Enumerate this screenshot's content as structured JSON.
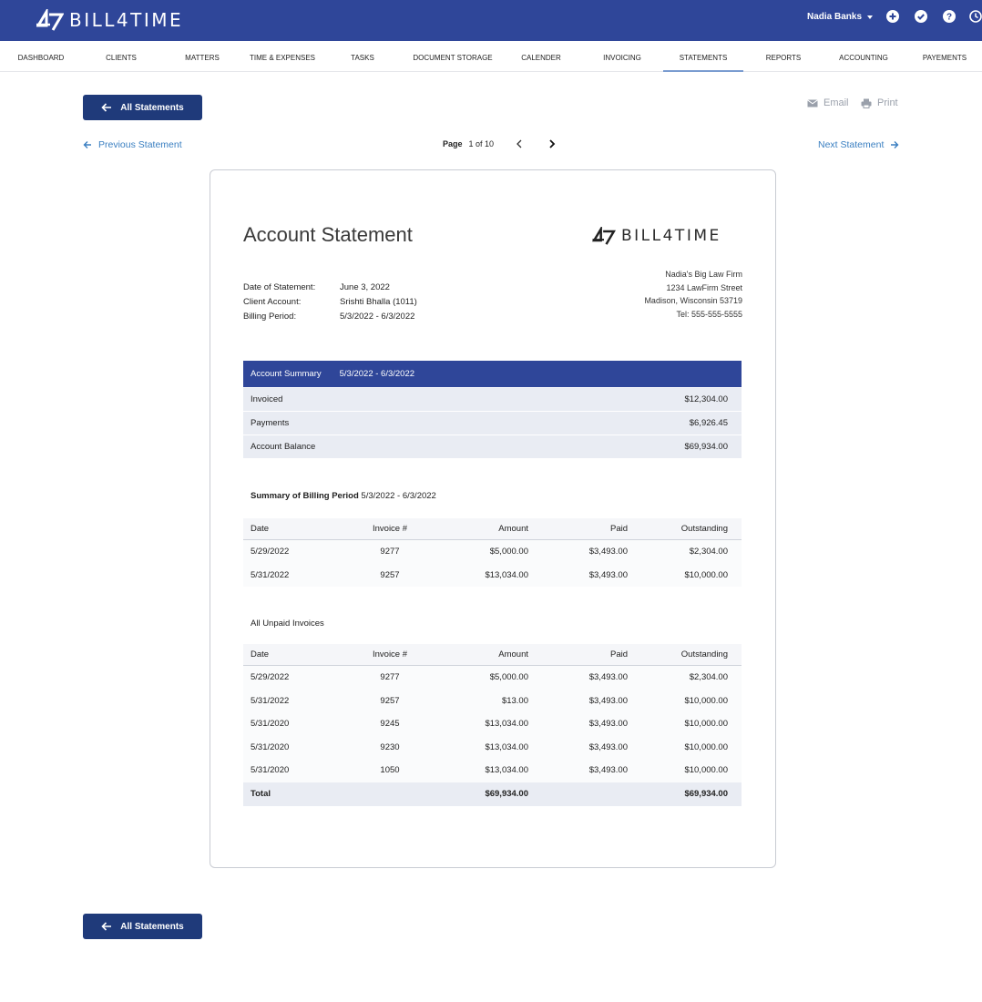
{
  "header": {
    "brand": "BILL4TIME",
    "user": "Nadia Banks",
    "icons": [
      "plus-icon",
      "check-icon",
      "help-icon",
      "clock-icon"
    ]
  },
  "nav": {
    "items": [
      "DASHBOARD",
      "CLIENTS",
      "MATTERS",
      "TIME & EXPENSES",
      "TASKS",
      "DOCUMENT STORAGE",
      "CALENDER",
      "INVOICING",
      "STATEMENTS",
      "REPORTS",
      "ACCOUNTING",
      "PAYEMENTS"
    ],
    "active": "STATEMENTS"
  },
  "actions": {
    "back_label": "All Statements",
    "email": "Email",
    "print": "Print",
    "previous": "Previous Statement",
    "next": "Next Statement",
    "page_label": "Page",
    "page_value": "1 of 10"
  },
  "statement": {
    "title": "Account Statement",
    "brand": "BILL4TIME",
    "meta": [
      {
        "label": "Date of Statement:",
        "value": "June 3, 2022"
      },
      {
        "label": "Client Account:",
        "value": "Srishti Bhalla (1011)"
      },
      {
        "label": "Billing Period:",
        "value": "5/3/2022 - 6/3/2022"
      }
    ],
    "firm": [
      "Nadia's Big Law Firm",
      "1234 LawFirm Street",
      "Madison, Wisconsin 53719",
      "Tel: 555-555-5555"
    ],
    "summary": {
      "title": "Account Summary",
      "range": "5/3/2022 - 6/3/2022",
      "rows": [
        {
          "label": "Invoiced",
          "value": "$12,304.00"
        },
        {
          "label": "Payments",
          "value": "$6,926.45"
        },
        {
          "label": "Account Balance",
          "value": "$69,934.00"
        }
      ]
    },
    "billing": {
      "title": "Summary of Billing Period",
      "range": "5/3/2022 - 6/3/2022",
      "columns": [
        "Date",
        "Invoice #",
        "Amount",
        "Paid",
        "Outstanding"
      ],
      "rows": [
        [
          "5/29/2022",
          "9277",
          "$5,000.00",
          "$3,493.00",
          "$2,304.00"
        ],
        [
          "5/31/2022",
          "9257",
          "$13,034.00",
          "$3,493.00",
          "$10,000.00"
        ]
      ]
    },
    "unpaid": {
      "title": "All Unpaid Invoices",
      "columns": [
        "Date",
        "Invoice #",
        "Amount",
        "Paid",
        "Outstanding"
      ],
      "rows": [
        [
          "5/29/2022",
          "9277",
          "$5,000.00",
          "$3,493.00",
          "$2,304.00"
        ],
        [
          "5/31/2022",
          "9257",
          "$13.00",
          "$3,493.00",
          "$10,000.00"
        ],
        [
          "5/31/2020",
          "9245",
          "$13,034.00",
          "$3,493.00",
          "$10,000.00"
        ],
        [
          "5/31/2020",
          "9230",
          "$13,034.00",
          "$3,493.00",
          "$10,000.00"
        ],
        [
          "5/31/2020",
          "1050",
          "$13,034.00",
          "$3,493.00",
          "$10,000.00"
        ]
      ],
      "total": {
        "label": "Total",
        "amount": "$69,934.00",
        "outstanding": "$69,934.00"
      }
    }
  },
  "colors": {
    "primary": "#2f4699",
    "button": "#1f3a7a",
    "link": "#3a7fc1",
    "band": "#e9ecf3"
  }
}
